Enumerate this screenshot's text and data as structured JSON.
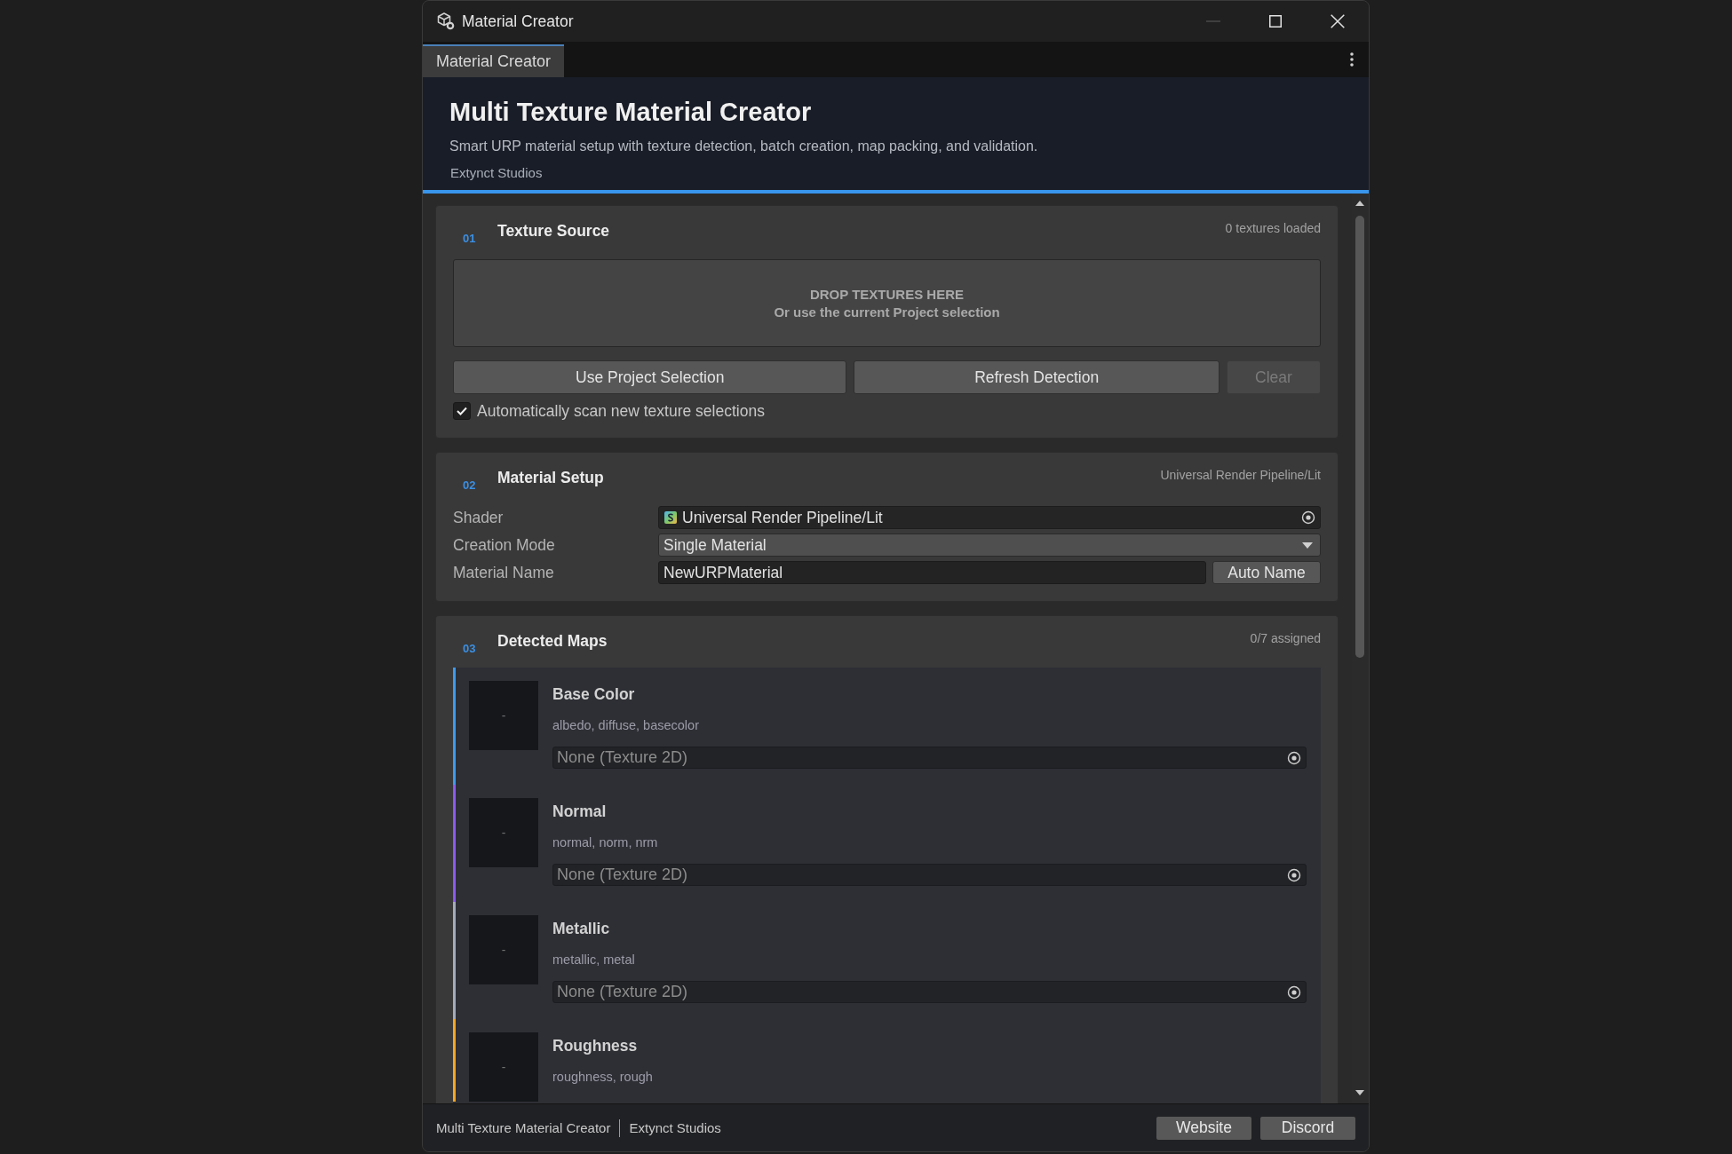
{
  "window": {
    "title": "Material Creator",
    "controls": [
      {
        "kind": "minimize",
        "disabled": true
      },
      {
        "kind": "maximize",
        "disabled": false
      },
      {
        "kind": "close",
        "disabled": false
      }
    ]
  },
  "tabs": [
    {
      "label": "Material Creator",
      "selected": true
    }
  ],
  "header": {
    "title": "Multi Texture Material Creator",
    "subtitle": "Smart URP material setup with texture detection, batch creation, map packing, and validation.",
    "studio": "Extynct Studios"
  },
  "sections": [
    {
      "kind": "source",
      "number": "01",
      "title": "Texture Source",
      "status": "0 textures loaded",
      "drop_zone": {
        "title": "DROP TEXTURES HERE",
        "hint": "Or use the current Project selection"
      },
      "buttons": [
        {
          "label": "Use Project Selection",
          "disabled": false
        },
        {
          "label": "Refresh Detection",
          "disabled": false
        },
        {
          "label": "Clear",
          "disabled": true
        }
      ],
      "auto_scan": {
        "label": "Automatically scan new texture selections",
        "checked": true
      }
    },
    {
      "kind": "setup",
      "number": "02",
      "title": "Material Setup",
      "status": "Universal Render Pipeline/Lit",
      "fields": [
        {
          "kind": "object",
          "label": "Shader",
          "value": "Universal Render Pipeline/Lit"
        },
        {
          "kind": "dropdown",
          "label": "Creation Mode",
          "value": "Single Material"
        },
        {
          "kind": "text",
          "label": "Material Name",
          "value": "NewURPMaterial",
          "button": "Auto Name"
        }
      ]
    },
    {
      "kind": "maps",
      "number": "03",
      "title": "Detected Maps",
      "status": "0/7 assigned",
      "maps": [
        {
          "name": "Base Color",
          "keywords": "albedo, diffuse, basecolor",
          "preview": "-",
          "color": "#3d9bf0",
          "placeholder": "None (Texture 2D)"
        },
        {
          "name": "Normal",
          "keywords": "normal, norm, nrm",
          "preview": "-",
          "color": "#8b5cf0",
          "placeholder": "None (Texture 2D)"
        },
        {
          "name": "Metallic",
          "keywords": "metallic, metal",
          "preview": "-",
          "color": "#a4acbc",
          "placeholder": "None (Texture 2D)"
        },
        {
          "name": "Roughness",
          "keywords": "roughness, rough",
          "preview": "-",
          "color": "#f5a623"
        }
      ]
    }
  ],
  "footer": {
    "product": "Multi Texture Material Creator",
    "studio": "Extynct Studios",
    "buttons": [
      "Website",
      "Discord"
    ]
  }
}
